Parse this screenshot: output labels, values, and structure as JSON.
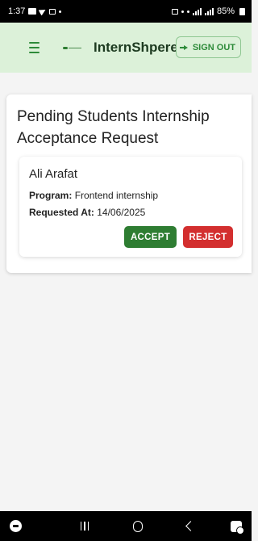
{
  "status_bar": {
    "time": "1:37",
    "battery": "85%"
  },
  "app_bar": {
    "title": "InternShpere",
    "sign_out_label": "SIGN OUT"
  },
  "panel": {
    "title": "Pending Students Internship Acceptance Request"
  },
  "requests": [
    {
      "name": "Ali Arafat",
      "program_label": "Program:",
      "program_value": "Frontend internship",
      "requested_label": "Requested At:",
      "requested_value": "14/06/2025",
      "accept_label": "ACCEPT",
      "reject_label": "REJECT"
    }
  ],
  "colors": {
    "app_bar_bg": "#dcf1d9",
    "accent_green": "#2e7d32",
    "reject_red": "#d32f2f"
  },
  "icons": {
    "menu": "hamburger-menu-icon",
    "logo": "internshpere-logo",
    "sign_out": "logout-icon",
    "nav": [
      "game-launcher-icon",
      "recents-icon",
      "home-icon",
      "back-icon",
      "keyboard-icon"
    ]
  }
}
